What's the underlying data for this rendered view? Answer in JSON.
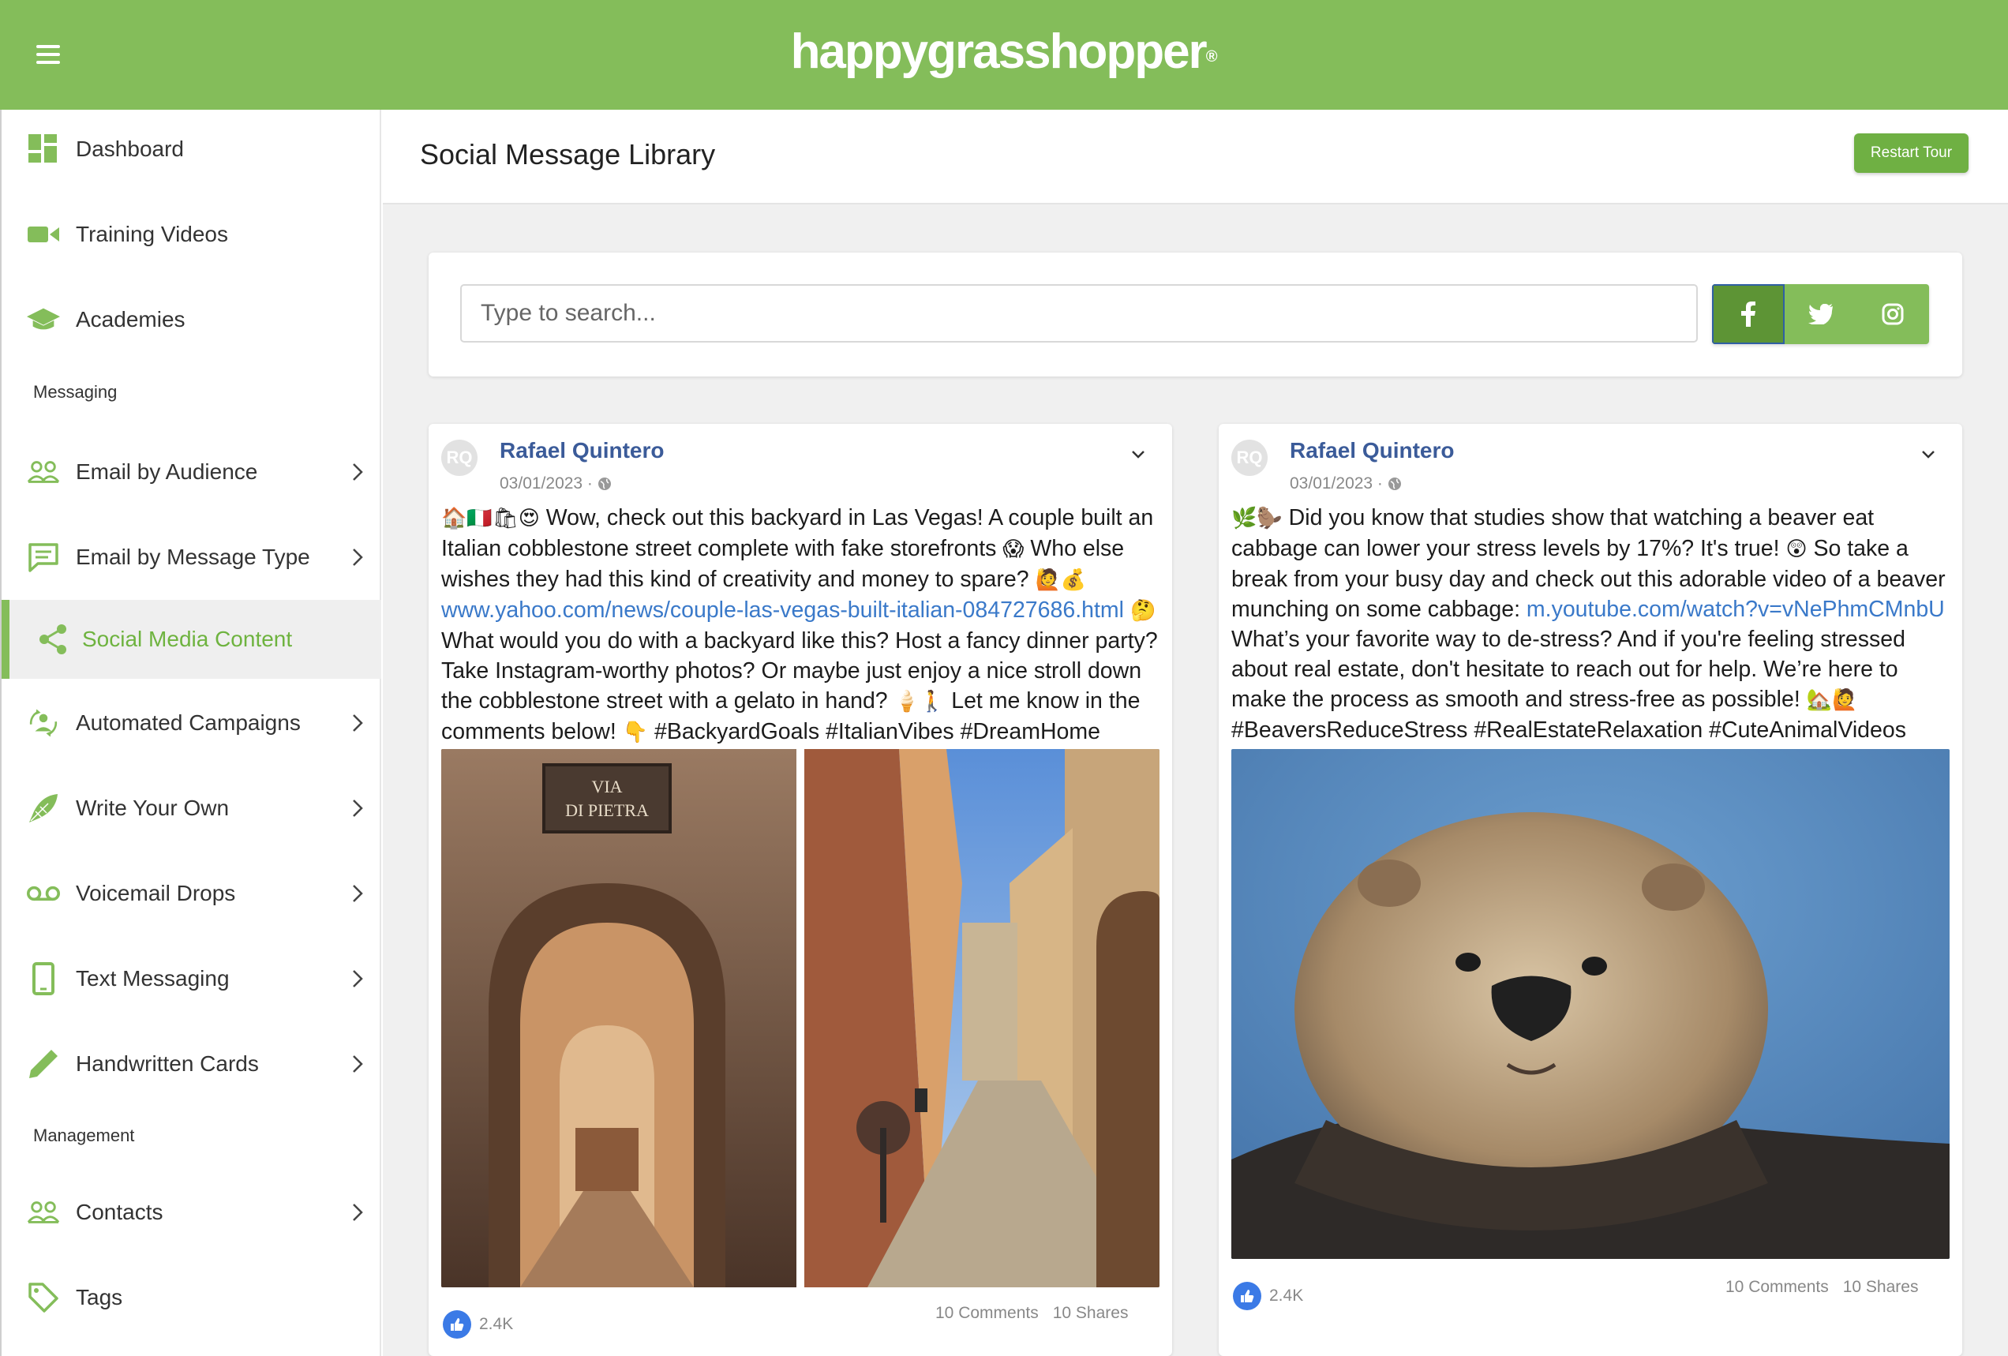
{
  "brand": {
    "name": "happygrasshopper",
    "mark": "®",
    "color": "#84bd5a"
  },
  "sidebar": {
    "items": [
      {
        "label": "Dashboard",
        "icon": "dashboard-icon"
      },
      {
        "label": "Training Videos",
        "icon": "video-camera-icon"
      },
      {
        "label": "Academies",
        "icon": "graduation-cap-icon"
      },
      {
        "label": "Email by Audience",
        "icon": "people-icon"
      },
      {
        "label": "Email by Message Type",
        "icon": "message-icon"
      },
      {
        "label": "Social Media Content",
        "icon": "share-icon"
      },
      {
        "label": "Automated Campaigns",
        "icon": "automation-icon"
      },
      {
        "label": "Write Your Own",
        "icon": "feather-icon"
      },
      {
        "label": "Voicemail Drops",
        "icon": "voicemail-icon"
      },
      {
        "label": "Text Messaging",
        "icon": "phone-icon"
      },
      {
        "label": "Handwritten Cards",
        "icon": "pen-icon"
      },
      {
        "label": "Contacts",
        "icon": "people-icon"
      },
      {
        "label": "Tags",
        "icon": "tag-icon"
      }
    ],
    "sections": {
      "messaging": "Messaging",
      "management": "Management"
    },
    "active": "Social Media Content"
  },
  "page": {
    "title": "Social Message Library",
    "restart_label": "Restart Tour"
  },
  "search": {
    "placeholder": "Type to search...",
    "value": ""
  },
  "social_filters": [
    {
      "name": "facebook",
      "active": true
    },
    {
      "name": "twitter",
      "active": false
    },
    {
      "name": "instagram",
      "active": false
    }
  ],
  "posts": [
    {
      "avatar": "RQ",
      "author": "Rafael Quintero",
      "date": "03/01/2023 ·",
      "emoji_lead": "🏠🇮🇹🛍😍",
      "text_1": " Wow, check out this backyard in Las Vegas! A couple built an Italian cobblestone street complete with fake storefronts ",
      "emoji_2": "😱",
      "text_2": " Who else wishes they had this kind of creativity and money to spare? ",
      "emoji_3": "🙋💰",
      "link": "www.yahoo.com/news/couple-las-vegas-built-italian-084727686.html",
      "emoji_4": " 🤔",
      "text_3": " What would you do with a backyard like this? Host a fancy dinner party? Take Instagram-worthy photos? Or maybe just enjoy a nice stroll down the cobblestone street with a gelato in hand? ",
      "emoji_5": "🍦🚶",
      "text_4": " Let me know in the comments below! ",
      "emoji_6": "👇",
      "text_5": " #BackyardGoals #ItalianVibes #DreamHome",
      "sign_text": "VIA DI PIETRA",
      "likes": "2.4K",
      "comments": "10 Comments",
      "shares": "10 Shares"
    },
    {
      "avatar": "RQ",
      "author": "Rafael Quintero",
      "date": "03/01/2023 ·",
      "emoji_lead": "🌿🦫",
      "text_1": " Did you know that studies show that watching a beaver eat cabbage can lower your stress levels by 17%? It's true! ",
      "emoji_2": "😲",
      "text_2": " So take a break from your busy day and check out this adorable video of a beaver munching on some cabbage: ",
      "link": "m.youtube.com/watch?v=vNePhmCMnbU",
      "text_3": " What’s your favorite way to de-stress? And if you're feeling stressed about real estate, don't hesitate to reach out for help. We’re here to make the process as smooth and stress-free as possible! ",
      "emoji_3": "🏡🙋",
      "text_4": " #BeaversReduceStress #RealEstateRelaxation #CuteAnimalVideos",
      "likes": "2.4K",
      "comments": "10 Comments",
      "shares": "10 Shares"
    }
  ]
}
